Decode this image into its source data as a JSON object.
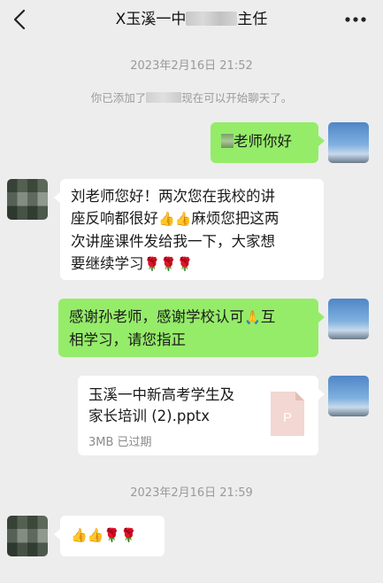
{
  "header": {
    "back_icon": "chevron-left-icon",
    "title_prefix": "X玉溪一中",
    "title_suffix": "主任",
    "more_icon": "ellipsis-icon"
  },
  "timestamps": [
    "2023年2月16日 21:52",
    "2023年2月16日 21:59"
  ],
  "system_message": {
    "prefix": "你已添加了",
    "suffix": "现在可以开始聊天了。"
  },
  "messages": [
    {
      "sender": "me",
      "text": "老师你好"
    },
    {
      "sender": "them",
      "line1": "刘老师您好！两次您在我校的讲",
      "line2a": "座反响都很好",
      "emoji_thumbs": "👍👍",
      "line2b": "麻烦您把这两",
      "line3": "次讲座课件发给我一下，大家想",
      "line4": "要继续学习",
      "emoji_roses": "🌹🌹🌹"
    },
    {
      "sender": "me",
      "line1": "感谢孙老师，感谢学校认可",
      "emoji_pray": "🙏",
      "line1b": "互",
      "line2": "相学习，请您指正"
    },
    {
      "sender": "me",
      "type": "file",
      "file_name_line1": "玉溪一中新高考学生及",
      "file_name_line2": "家长培训 (2).pptx",
      "file_meta": "3MB  已过期",
      "file_icon_letter": "P"
    },
    {
      "sender": "them",
      "emoji": "👍👍🌹🌹"
    }
  ]
}
